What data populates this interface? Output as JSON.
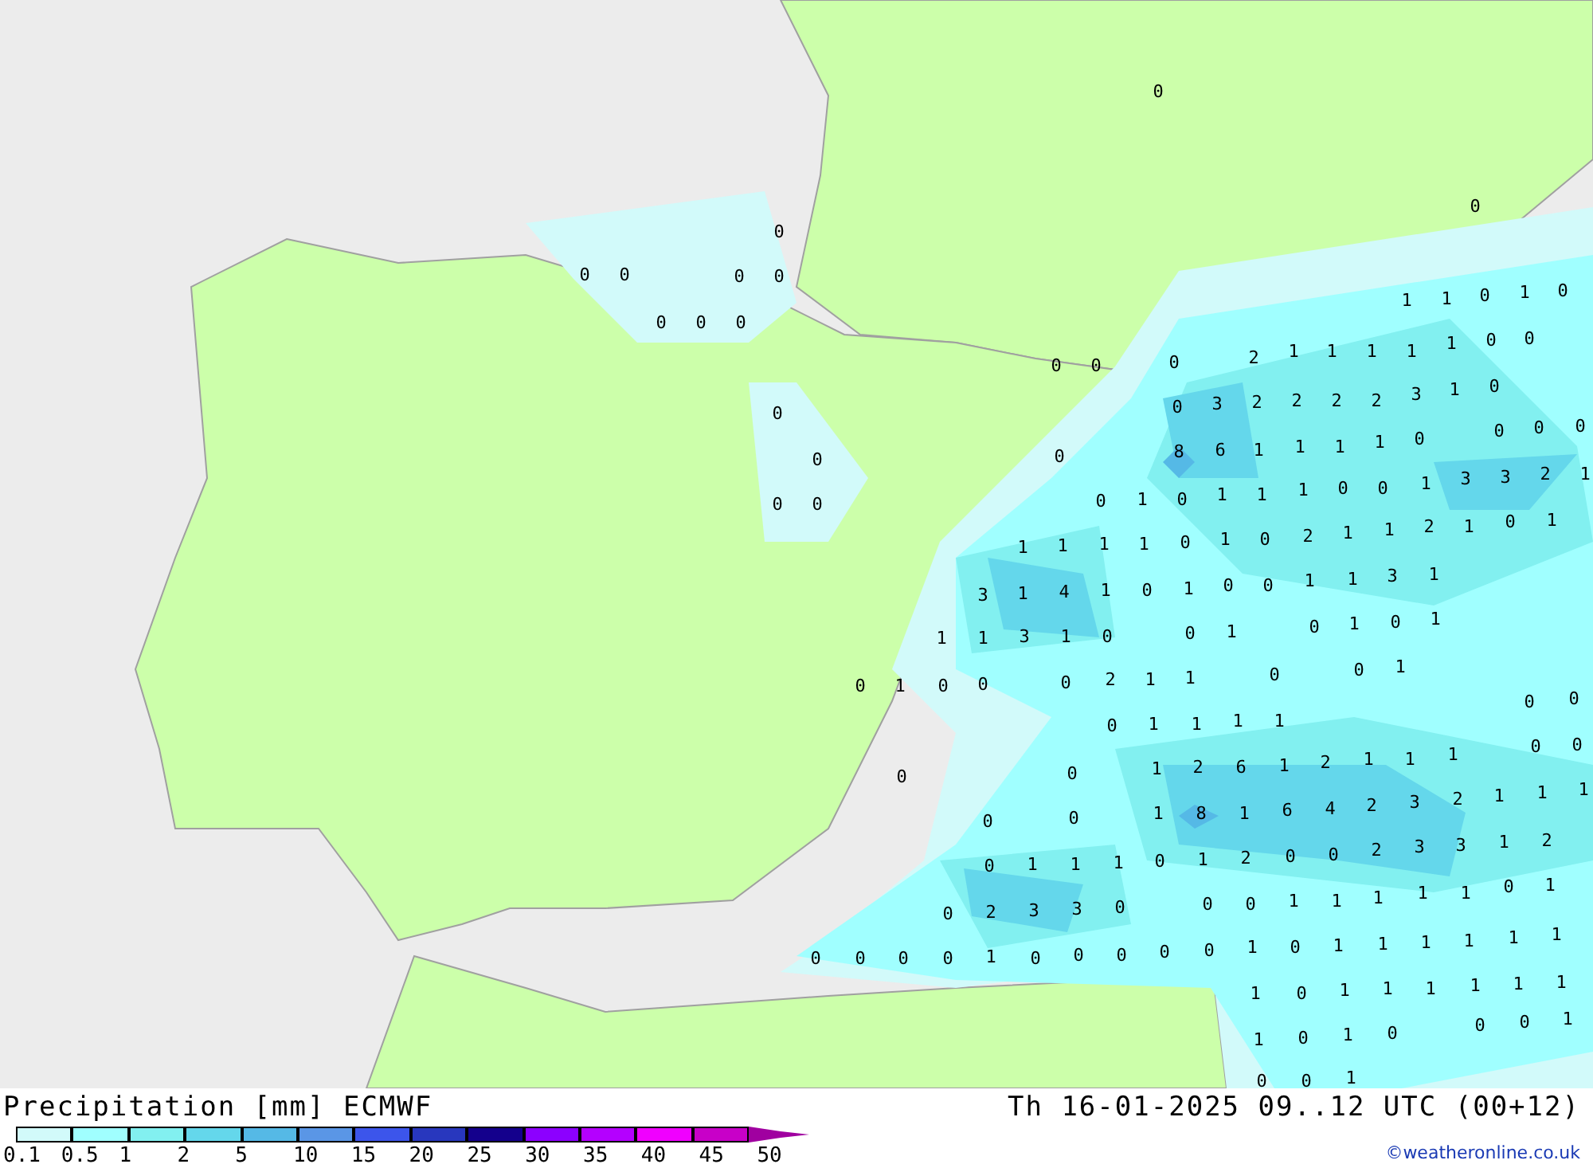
{
  "map": {
    "values": [
      "0",
      "0",
      "0",
      "0",
      "0",
      "0",
      "0",
      "0",
      "0",
      "0",
      "0",
      "0",
      "0",
      "0",
      "0",
      "1",
      "1",
      "0",
      "1",
      "0",
      "0",
      "0",
      "0",
      "2",
      "1",
      "1",
      "1",
      "1",
      "1",
      "0",
      "0",
      "0",
      "3",
      "2",
      "2",
      "2",
      "2",
      "3",
      "1",
      "0",
      "8",
      "6",
      "1",
      "1",
      "1",
      "1",
      "0",
      "0",
      "0",
      "0",
      "0",
      "1",
      "0",
      "1",
      "1",
      "1",
      "0",
      "0",
      "1",
      "3",
      "3",
      "2",
      "1",
      "1",
      "1",
      "1",
      "1",
      "0",
      "1",
      "0",
      "2",
      "1",
      "1",
      "2",
      "1",
      "0",
      "1",
      "3",
      "1",
      "4",
      "1",
      "0",
      "1",
      "0",
      "0",
      "1",
      "1",
      "3",
      "1",
      "1",
      "1",
      "3",
      "1",
      "0",
      "0",
      "1",
      "0",
      "1",
      "0",
      "1",
      "0",
      "1",
      "0",
      "0",
      "0",
      "2",
      "1",
      "1",
      "0",
      "0",
      "1",
      "0",
      "0",
      "0",
      "1",
      "1",
      "1",
      "1",
      "0",
      "0",
      "0",
      "0",
      "1",
      "2",
      "6",
      "1",
      "2",
      "1",
      "1",
      "1",
      "1",
      "8",
      "1",
      "6",
      "4",
      "2",
      "3",
      "2",
      "1",
      "1",
      "1",
      "0",
      "0",
      "0",
      "1",
      "1",
      "1",
      "0",
      "1",
      "2",
      "0",
      "0",
      "2",
      "3",
      "3",
      "1",
      "2",
      "0",
      "2",
      "3",
      "3",
      "0",
      "0",
      "0",
      "1",
      "1",
      "1",
      "1",
      "1",
      "0",
      "1",
      "0",
      "0",
      "0",
      "0",
      "1",
      "0",
      "0",
      "0",
      "0",
      "0",
      "1",
      "0",
      "1",
      "1",
      "1",
      "1",
      "1",
      "1",
      "1",
      "0",
      "1",
      "1",
      "1",
      "1",
      "1",
      "1",
      "0",
      "0",
      "1",
      "1",
      "0",
      "1",
      "0",
      "0",
      "0",
      "1"
    ]
  },
  "legend": {
    "title": "Precipitation [mm] ECMWF",
    "valid_time": "Th 16-01-2025 09..12 UTC (00+12)",
    "scale": [
      {
        "label": "0.1",
        "color": "#d2fafa"
      },
      {
        "label": "0.5",
        "color": "#a0ffff"
      },
      {
        "label": "1",
        "color": "#82f0f0"
      },
      {
        "label": "2",
        "color": "#64d7eb"
      },
      {
        "label": "5",
        "color": "#55b9e6"
      },
      {
        "label": "10",
        "color": "#5a96e6"
      },
      {
        "label": "15",
        "color": "#3c55eb"
      },
      {
        "label": "20",
        "color": "#2837be"
      },
      {
        "label": "25",
        "color": "#14008c"
      },
      {
        "label": "30",
        "color": "#8c00ff"
      },
      {
        "label": "35",
        "color": "#b400ff"
      },
      {
        "label": "40",
        "color": "#f000ff"
      },
      {
        "label": "45",
        "color": "#c800c8"
      },
      {
        "label": "50",
        "color": "#a000a0"
      }
    ],
    "credit": "©weatheronline.co.uk"
  }
}
